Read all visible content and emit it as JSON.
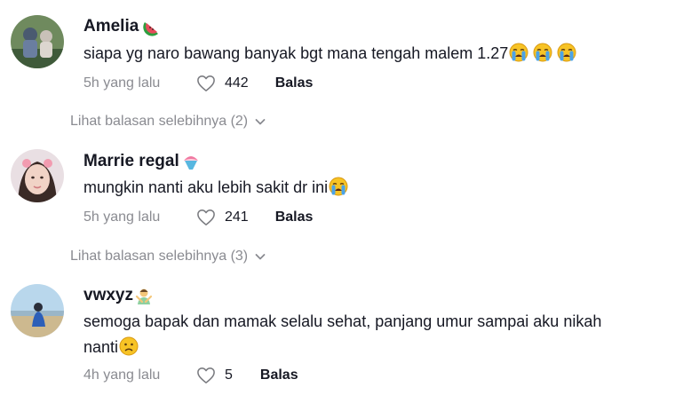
{
  "comments": [
    {
      "username": "Amelia",
      "badge_icon": "watermelon-icon",
      "text": "siapa yg naro bawang banyak bgt mana tengah malem 1.27",
      "emojis": [
        "loudly-crying-face-icon",
        "loudly-crying-face-icon",
        "loudly-crying-face-icon"
      ],
      "time": "5h yang lalu",
      "likes": "442",
      "reply_label": "Balas",
      "more_replies": "Lihat balasan selebihnya (2)"
    },
    {
      "username": "Marrie regal",
      "badge_icon": "shaved-ice-icon",
      "text": "mungkin nanti aku lebih sakit dr ini",
      "emojis": [
        "loudly-crying-face-icon"
      ],
      "time": "5h yang lalu",
      "likes": "241",
      "reply_label": "Balas",
      "more_replies": "Lihat balasan selebihnya (3)"
    },
    {
      "username": "vwxyz",
      "badge_icon": "person-gesturing-no-icon",
      "text_line1": "semoga bapak dan mamak selalu sehat, panjang umur sampai aku nikah",
      "text_line2": "nanti",
      "emojis": [
        "frowning-face-icon"
      ],
      "time": "4h yang lalu",
      "likes": "5",
      "reply_label": "Balas"
    }
  ],
  "colors": {
    "text": "#161823",
    "muted": "#8a8b91",
    "emoji_yellow": "#f7c325",
    "tears_blue": "#4ba3e8"
  }
}
